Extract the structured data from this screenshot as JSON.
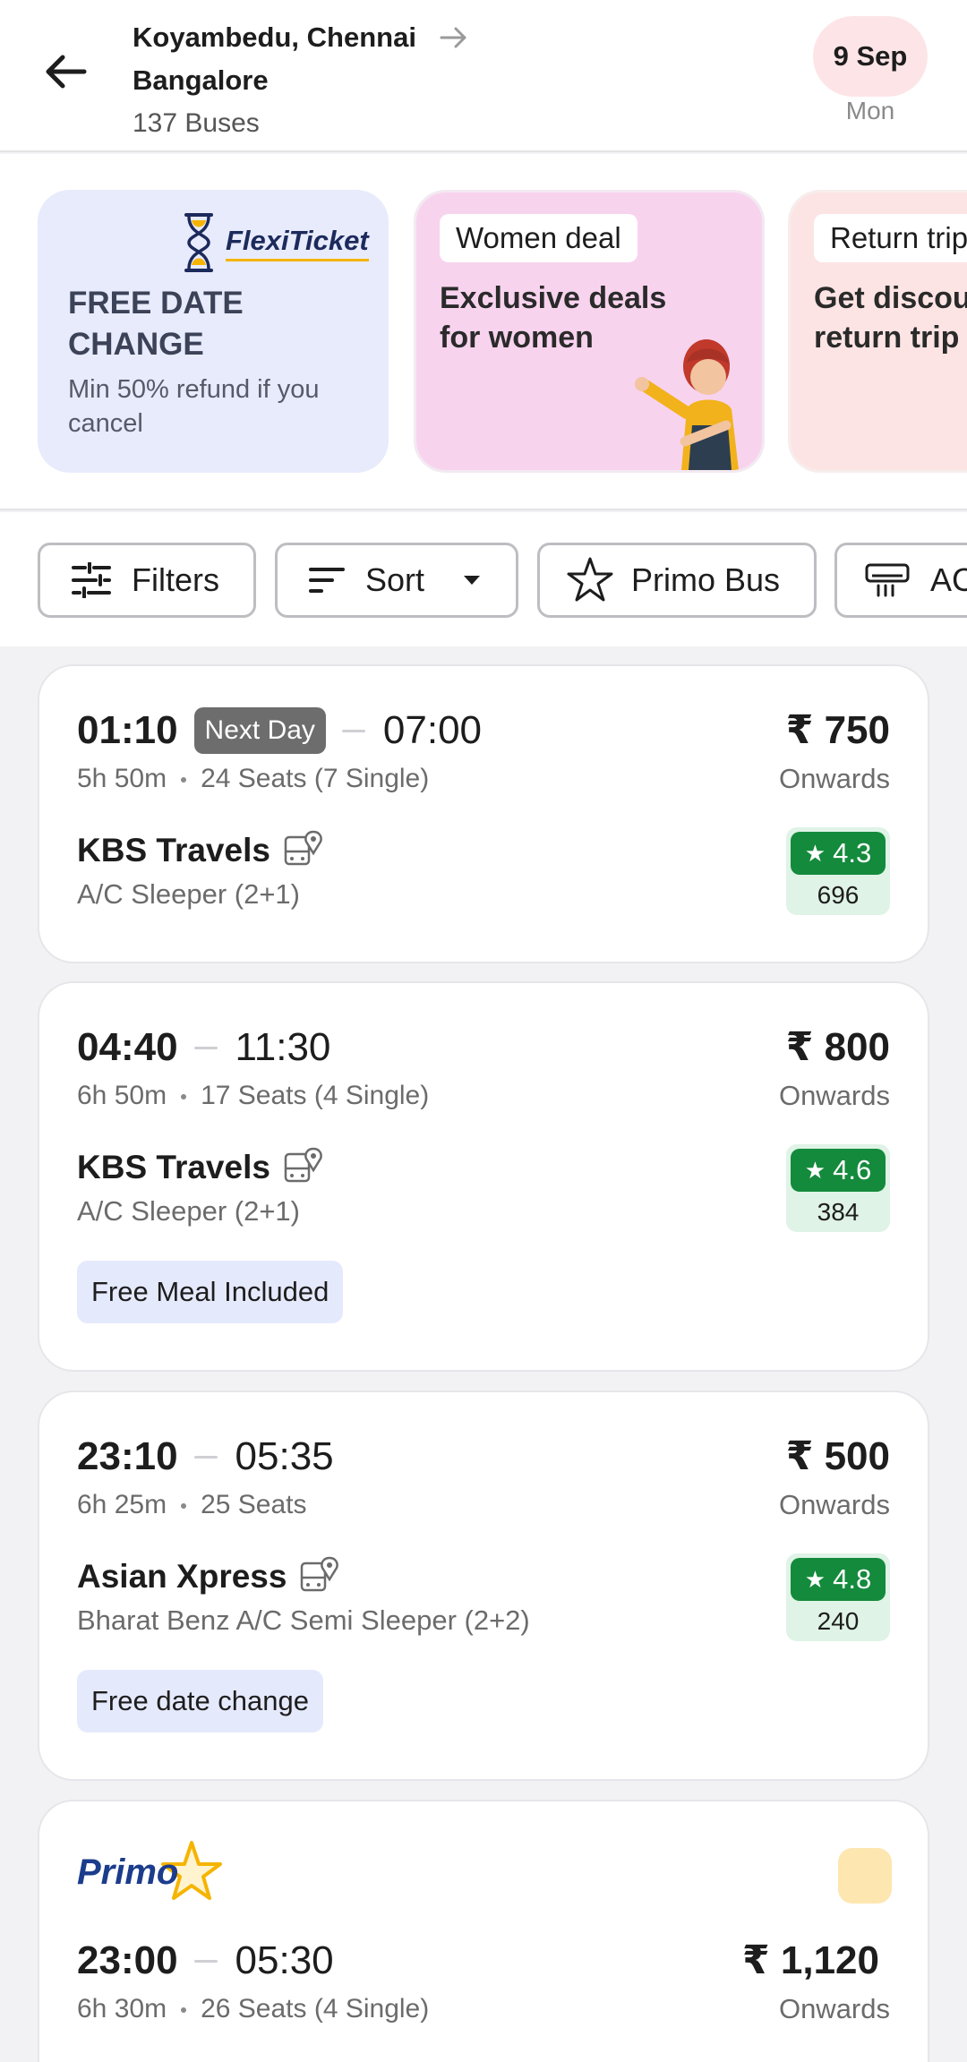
{
  "header": {
    "origin": "Koyambedu, Chennai",
    "destination": "Bangalore",
    "bus_count": "137 Buses",
    "date": "9 Sep",
    "weekday": "Mon"
  },
  "offers": [
    {
      "logo_text": "FlexiTicket",
      "title": "FREE DATE CHANGE",
      "subtitle": "Min 50% refund if you cancel"
    },
    {
      "tag": "Women deal",
      "title": "Exclusive deals for women"
    },
    {
      "tag": "Return trip",
      "title": "Get discount on return trip"
    }
  ],
  "chips": {
    "filters": "Filters",
    "sort": "Sort",
    "primo": "Primo Bus",
    "ac": "AC"
  },
  "buses": [
    {
      "departure": "01:10",
      "next_day": "Next Day",
      "arrival": "07:00",
      "duration": "5h 50m",
      "seats": "24 Seats (7 Single)",
      "price": "₹ 750",
      "onwards": "Onwards",
      "operator": "KBS Travels",
      "type": "A/C Sleeper (2+1)",
      "rating": "4.3",
      "reviews": "696"
    },
    {
      "departure": "04:40",
      "arrival": "11:30",
      "duration": "6h 50m",
      "seats": "17 Seats (4 Single)",
      "price": "₹ 800",
      "onwards": "Onwards",
      "operator": "KBS Travels",
      "type": "A/C Sleeper (2+1)",
      "rating": "4.6",
      "reviews": "384",
      "badge": "Free Meal Included"
    },
    {
      "departure": "23:10",
      "arrival": "05:35",
      "duration": "6h 25m",
      "seats": "25 Seats",
      "price": "₹ 500",
      "onwards": "Onwards",
      "operator": "Asian Xpress",
      "type": "Bharat Benz A/C Semi Sleeper (2+2)",
      "rating": "4.8",
      "reviews": "240",
      "badge": "Free date change"
    },
    {
      "logo": "Primo",
      "departure": "23:00",
      "arrival": "05:30",
      "duration": "6h 30m",
      "seats": "26 Seats (4 Single)",
      "price": "₹ 1,120",
      "onwards": "Onwards"
    }
  ],
  "colors": {
    "rating_green": "#148a3c",
    "date_pill": "#fde5e7",
    "flexi_bg": "#e8ebfc",
    "women_bg": "#f8d3ee",
    "badge_bg": "#e5e9fc"
  }
}
